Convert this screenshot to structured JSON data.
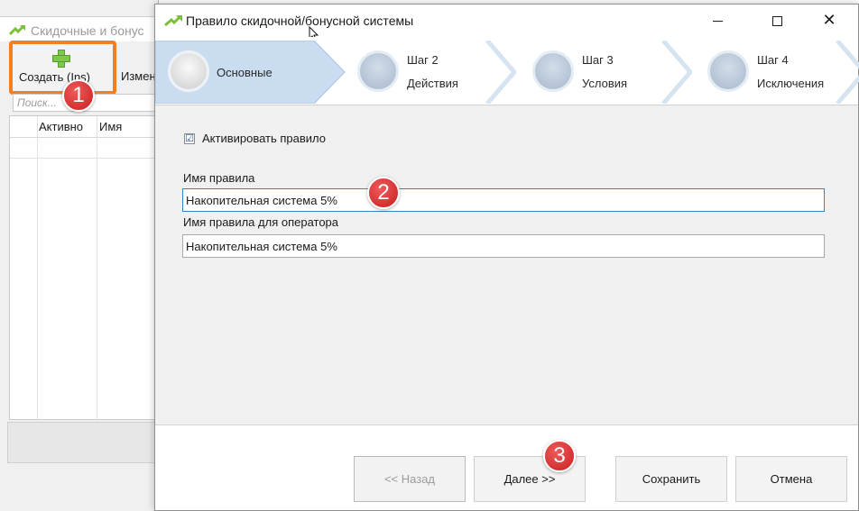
{
  "background_window": {
    "title": "Скидочные и бонус",
    "toolbar": {
      "create_label": "Создать (Ins)",
      "edit_label": "Измен"
    },
    "search": {
      "placeholder": "Поиск..."
    },
    "grid_columns": [
      "Активно",
      "Имя"
    ]
  },
  "dialog": {
    "title": "Правило скидочной/бонусной системы",
    "steps": [
      {
        "title": "Основные",
        "subtitle": ""
      },
      {
        "title": "Шаг 2",
        "subtitle": "Действия"
      },
      {
        "title": "Шаг 3",
        "subtitle": "Условия"
      },
      {
        "title": "Шаг 4",
        "subtitle": "Исключения"
      }
    ],
    "active_step": 0,
    "activate_checkbox": {
      "label": "Активировать правило",
      "checked": true,
      "check_glyph": "☑"
    },
    "rule_name": {
      "label": "Имя правила",
      "value": "Накопительная система 5%"
    },
    "operator_name": {
      "label": "Имя правила для оператора",
      "value": "Накопительная система 5%"
    },
    "buttons": {
      "back": "<< Назад",
      "next": "Далее >>",
      "save": "Сохранить",
      "cancel": "Отмена"
    },
    "window_controls": {
      "close_glyph": "✕"
    }
  },
  "badges": [
    "1",
    "2",
    "3"
  ],
  "colors": {
    "highlight_border": "#f57f1f",
    "badge": "#d62828",
    "active_step": "#c9dcf0",
    "focus_border": "#3c7fc4",
    "app_icon": "#7cbf3a"
  }
}
